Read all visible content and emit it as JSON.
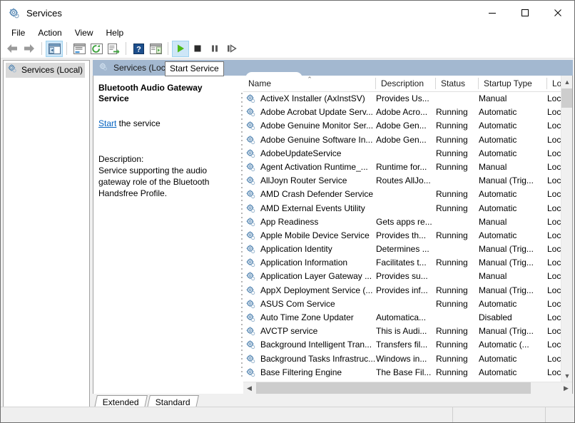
{
  "window": {
    "title": "Services",
    "icon": "services-gear-icon",
    "controls": {
      "minimize": "minimize-icon",
      "maximize": "maximize-icon",
      "close": "close-icon"
    }
  },
  "menubar": {
    "items": [
      {
        "label": "File"
      },
      {
        "label": "Action"
      },
      {
        "label": "View"
      },
      {
        "label": "Help"
      }
    ]
  },
  "toolbar": {
    "buttons": [
      {
        "name": "back-icon",
        "title": "Back"
      },
      {
        "name": "forward-icon",
        "title": "Forward"
      },
      {
        "name": "show-hide-console-tree-icon",
        "title": "Show/Hide Console Tree",
        "active": true
      },
      {
        "name": "properties-icon",
        "title": "Properties"
      },
      {
        "name": "refresh-icon",
        "title": "Refresh"
      },
      {
        "name": "export-list-icon",
        "title": "Export List"
      },
      {
        "name": "help-icon",
        "title": "Help"
      },
      {
        "name": "show-action-pane-icon",
        "title": "Show/Hide Action Pane"
      },
      {
        "name": "start-service-icon",
        "title": "Start Service",
        "active": true
      },
      {
        "name": "stop-service-icon",
        "title": "Stop Service"
      },
      {
        "name": "pause-service-icon",
        "title": "Pause Service"
      },
      {
        "name": "restart-service-icon",
        "title": "Restart Service"
      }
    ]
  },
  "tooltip": {
    "text": "Start Service"
  },
  "tree": {
    "root_label": "Services (Local)",
    "root_icon": "services-gear-icon"
  },
  "mmc_tab": {
    "label": "Services (Local)",
    "icon": "services-gear-icon",
    "header_color": "#a3b8d0"
  },
  "detail": {
    "title": "Bluetooth Audio Gateway Service",
    "action_link": "Start",
    "action_suffix": " the service",
    "description_label": "Description:",
    "description_text": "Service supporting the audio gateway role of the Bluetooth Handsfree Profile.",
    "link_color": "#0563c1"
  },
  "list": {
    "columns": [
      {
        "key": "name",
        "label": "Name",
        "sorted": "asc"
      },
      {
        "key": "desc",
        "label": "Description",
        "sorted": ""
      },
      {
        "key": "status",
        "label": "Status",
        "sorted": ""
      },
      {
        "key": "startup",
        "label": "Startup Type",
        "sorted": ""
      },
      {
        "key": "logon",
        "label": "Log",
        "sorted": ""
      }
    ],
    "sort_arrow_glyph": "⌃",
    "row_icon": "service-gear-icon",
    "rows": [
      {
        "name": "ActiveX Installer (AxInstSV)",
        "desc": "Provides Us...",
        "status": "",
        "startup": "Manual",
        "logon": "Loc¦"
      },
      {
        "name": "Adobe Acrobat Update Serv...",
        "desc": "Adobe Acro...",
        "status": "Running",
        "startup": "Automatic",
        "logon": "Loc¦"
      },
      {
        "name": "Adobe Genuine Monitor Ser...",
        "desc": "Adobe Gen...",
        "status": "Running",
        "startup": "Automatic",
        "logon": "Loc¦"
      },
      {
        "name": "Adobe Genuine Software In...",
        "desc": "Adobe Gen...",
        "status": "Running",
        "startup": "Automatic",
        "logon": "Loc¦"
      },
      {
        "name": "AdobeUpdateService",
        "desc": "",
        "status": "Running",
        "startup": "Automatic",
        "logon": "Loc¦"
      },
      {
        "name": "Agent Activation Runtime_...",
        "desc": "Runtime for...",
        "status": "Running",
        "startup": "Manual",
        "logon": "Loc¦"
      },
      {
        "name": "AllJoyn Router Service",
        "desc": "Routes AllJo...",
        "status": "",
        "startup": "Manual (Trig...",
        "logon": "Loc¦"
      },
      {
        "name": "AMD Crash Defender Service",
        "desc": "",
        "status": "Running",
        "startup": "Automatic",
        "logon": "Loc¦"
      },
      {
        "name": "AMD External Events Utility",
        "desc": "",
        "status": "Running",
        "startup": "Automatic",
        "logon": "Loc¦"
      },
      {
        "name": "App Readiness",
        "desc": "Gets apps re...",
        "status": "",
        "startup": "Manual",
        "logon": "Loc¦"
      },
      {
        "name": "Apple Mobile Device Service",
        "desc": "Provides th...",
        "status": "Running",
        "startup": "Automatic",
        "logon": "Loc¦"
      },
      {
        "name": "Application Identity",
        "desc": "Determines ...",
        "status": "",
        "startup": "Manual (Trig...",
        "logon": "Loc¦"
      },
      {
        "name": "Application Information",
        "desc": "Facilitates t...",
        "status": "Running",
        "startup": "Manual (Trig...",
        "logon": "Loc¦"
      },
      {
        "name": "Application Layer Gateway ...",
        "desc": "Provides su...",
        "status": "",
        "startup": "Manual",
        "logon": "Loc¦"
      },
      {
        "name": "AppX Deployment Service (...",
        "desc": "Provides inf...",
        "status": "Running",
        "startup": "Manual (Trig...",
        "logon": "Loc¦"
      },
      {
        "name": "ASUS Com Service",
        "desc": "",
        "status": "Running",
        "startup": "Automatic",
        "logon": "Loc¦"
      },
      {
        "name": "Auto Time Zone Updater",
        "desc": "Automatica...",
        "status": "",
        "startup": "Disabled",
        "logon": "Loc¦"
      },
      {
        "name": "AVCTP service",
        "desc": "This is Audi...",
        "status": "Running",
        "startup": "Manual (Trig...",
        "logon": "Loc¦"
      },
      {
        "name": "Background Intelligent Tran...",
        "desc": "Transfers fil...",
        "status": "Running",
        "startup": "Automatic (...",
        "logon": "Loc¦"
      },
      {
        "name": "Background Tasks Infrastruc...",
        "desc": "Windows in...",
        "status": "Running",
        "startup": "Automatic",
        "logon": "Loc¦"
      },
      {
        "name": "Base Filtering Engine",
        "desc": "The Base Fil...",
        "status": "Running",
        "startup": "Automatic",
        "logon": "Loc¦"
      }
    ]
  },
  "bottom_tabs": [
    {
      "label": "Extended",
      "selected": true
    },
    {
      "label": "Standard",
      "selected": false
    }
  ],
  "statusbar": {
    "segments": [
      "",
      "",
      ""
    ]
  }
}
